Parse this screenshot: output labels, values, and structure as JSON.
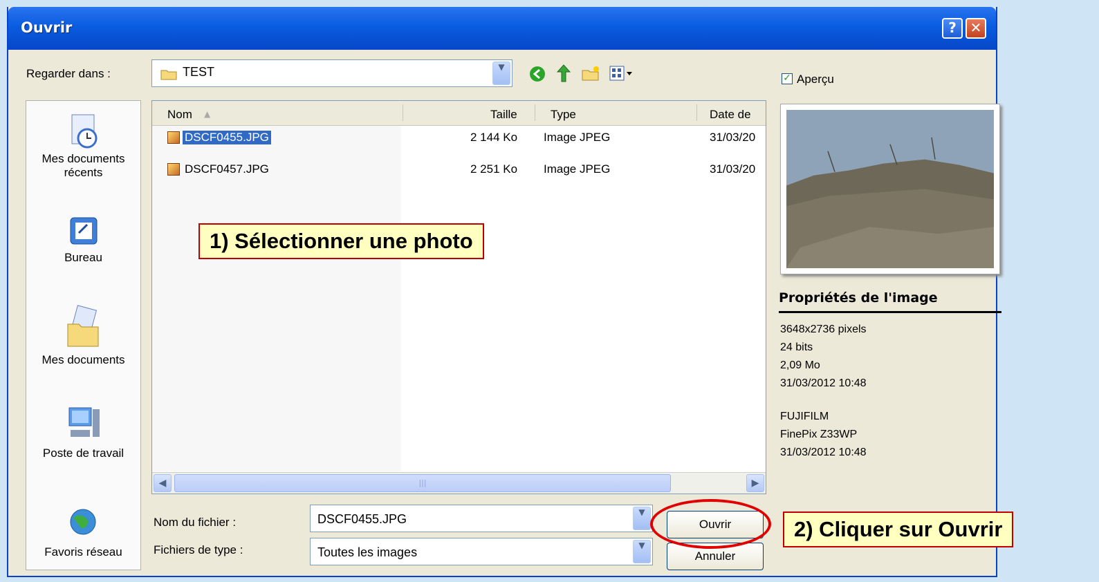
{
  "window": {
    "title": "Ouvrir",
    "help_glyph": "?",
    "close_glyph": "✕"
  },
  "toolbar": {
    "look_in_label": "Regarder dans :",
    "look_in_value": "TEST",
    "preview_label": "Aperçu",
    "preview_checked": true
  },
  "places": [
    {
      "label": "Mes documents récents",
      "icon": "recent-documents-icon"
    },
    {
      "label": "Bureau",
      "icon": "desktop-icon"
    },
    {
      "label": "Mes documents",
      "icon": "my-documents-icon"
    },
    {
      "label": "Poste de travail",
      "icon": "my-computer-icon"
    },
    {
      "label": "Favoris réseau",
      "icon": "network-places-icon"
    }
  ],
  "file_list": {
    "columns": [
      "Nom",
      "Taille",
      "Type",
      "Date de"
    ],
    "rows": [
      {
        "name": "DSCF0455.JPG",
        "size": "2 144 Ko",
        "type": "Image JPEG",
        "date": "31/03/20",
        "selected": true
      },
      {
        "name": "DSCF0457.JPG",
        "size": "2 251 Ko",
        "type": "Image JPEG",
        "date": "31/03/20",
        "selected": false
      }
    ]
  },
  "form": {
    "filename_label": "Nom du fichier :",
    "filename_value": "DSCF0455.JPG",
    "filetype_label": "Fichiers de type :",
    "filetype_value": "Toutes les images",
    "open_button": "Ouvrir",
    "cancel_button": "Annuler"
  },
  "properties": {
    "title": "Propriétés de l'image",
    "lines": [
      "3648x2736 pixels",
      "24 bits",
      "2,09 Mo",
      "31/03/2012 10:48"
    ],
    "camera_lines": [
      "FUJIFILM",
      "FinePix Z33WP",
      "31/03/2012 10:48"
    ]
  },
  "annotations": {
    "step1": "1) Sélectionner une photo",
    "step2": "2) Cliquer sur Ouvrir"
  },
  "colors": {
    "titlebar": "#0a5ce0",
    "selection": "#316ac5",
    "annotation_border": "#c00000",
    "annotation_fill": "#ffffc0"
  }
}
